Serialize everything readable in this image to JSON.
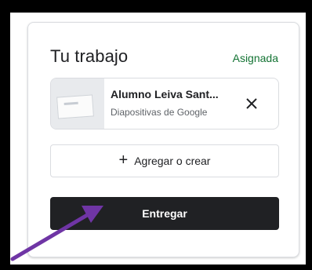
{
  "card": {
    "title": "Tu trabajo",
    "status": "Asignada",
    "attachment": {
      "name": "Alumno Leiva Sant...",
      "type": "Diapositivas de Google",
      "close_icon": "close-icon"
    },
    "add_button": {
      "icon": "plus-icon",
      "label": "Agregar o crear"
    },
    "submit_button": {
      "label": "Entregar"
    }
  },
  "colors": {
    "status": "#137333",
    "submit_bg": "#202124",
    "annotation_arrow": "#6f35a5"
  }
}
